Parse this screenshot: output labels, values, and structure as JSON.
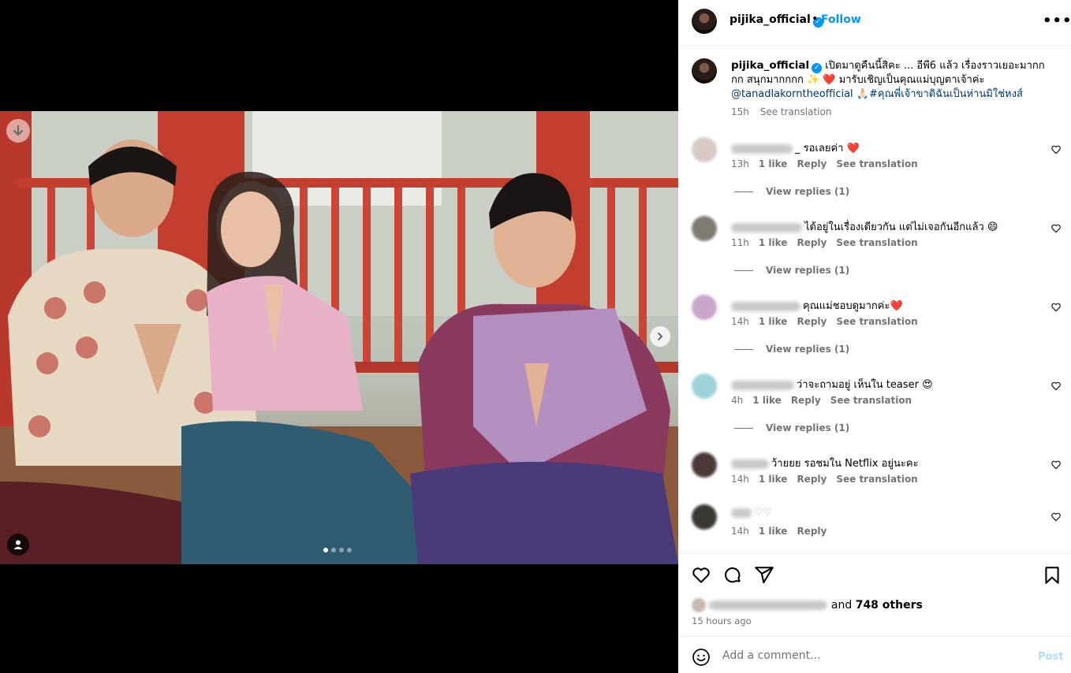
{
  "post": {
    "username": "pijika_official",
    "follow_label": "Follow",
    "dot": "•",
    "more_label": "•••",
    "verified_mark": "✓"
  },
  "caption": {
    "username": "pijika_official",
    "text": "เปิดมาดูคืนนี้สิคะ ... อีพี6 แล้ว เรื่องราวเยอะมากกกก สนุกมากกกก ✨ ❤️ มารับเชิญเป็นคุณแม่บุญตาเจ้าค่ะ",
    "mention": "@tanadlakorntheofficial",
    "emoji": "🙏🏻",
    "hashtag": "#คุณพี่เจ้าขาดิฉันเป็นห่านมิใช่หงส์",
    "time": "15h",
    "see_translation": "See translation"
  },
  "comments": [
    {
      "text": "_ รอเลยค่า ❤️",
      "time": "13h",
      "likes": "1 like",
      "reply": "Reply",
      "translate": "See translation",
      "view_replies": "View replies (1)",
      "avatar_color": "#d8c9c5"
    },
    {
      "text": "ได้อยู่ในเรื่องเดียวกัน แต่ไม่เจอกันอีกแล้ว 😄",
      "time": "11h",
      "likes": "1 like",
      "reply": "Reply",
      "translate": "See translation",
      "view_replies": "View replies (1)",
      "avatar_color": "#7f7a72"
    },
    {
      "text": "คุณแม่ชอบดูมากค่ะ❤️",
      "time": "14h",
      "likes": "1 like",
      "reply": "Reply",
      "translate": "See translation",
      "view_replies": "View replies (1)",
      "avatar_color": "#c8a6c9"
    },
    {
      "text": "ว่าจะถามอยู่ เห็นใน teaser 😍",
      "time": "4h",
      "likes": "1 like",
      "reply": "Reply",
      "translate": "See translation",
      "view_replies": "View replies (1)",
      "avatar_color": "#9cd3d8"
    },
    {
      "text": "ว้ายยย รอชมใน Netflix อยู่นะคะ",
      "time": "14h",
      "likes": "1 like",
      "reply": "Reply",
      "translate": "See translation",
      "view_replies": "",
      "avatar_color": "#4d3a38"
    },
    {
      "text": "♡♡",
      "time": "14h",
      "likes": "1 like",
      "reply": "Reply",
      "translate": "",
      "view_replies": "",
      "avatar_color": "#3b3834"
    }
  ],
  "actions": {
    "likes_suffix": "and",
    "likes_others": "748 others",
    "post_time": "15 hours ago"
  },
  "comment_box": {
    "placeholder": "Add a comment...",
    "post_label": "Post"
  },
  "carousel": {
    "slides": 4,
    "active_slide": 1
  },
  "colors": {
    "accent": "#0095f6",
    "secondary_text": "#737373",
    "link": "#00376b",
    "post_disabled": "#b3dbff"
  }
}
